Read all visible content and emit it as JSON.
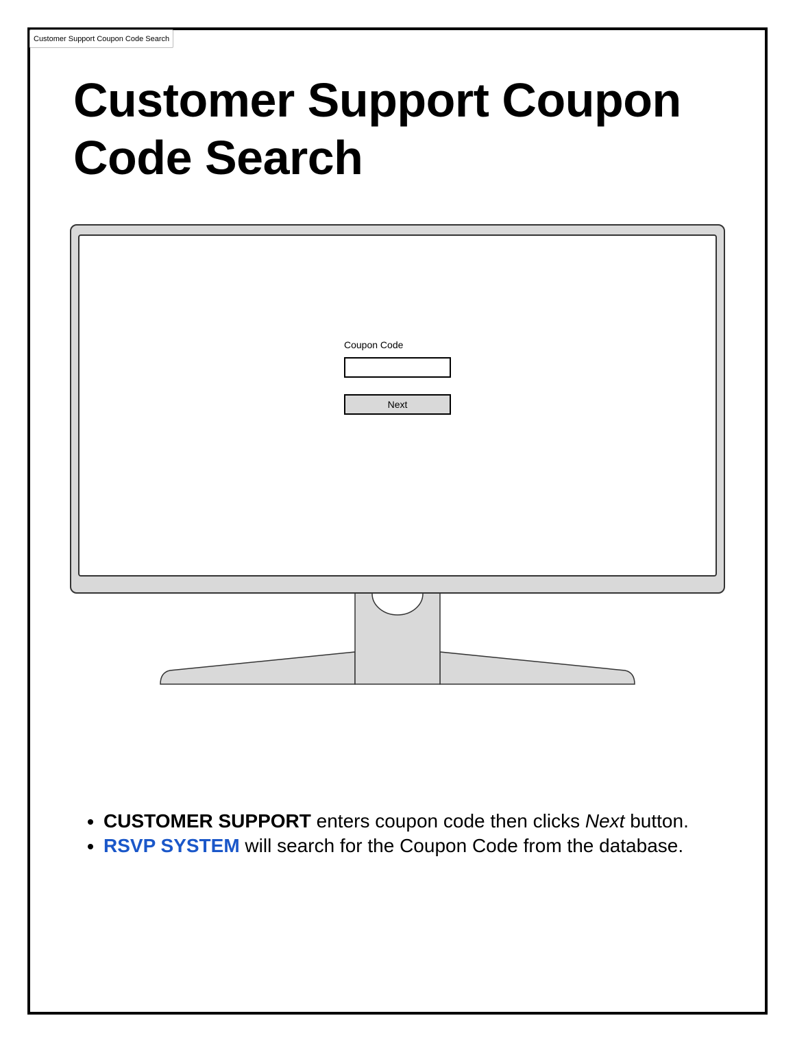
{
  "tab": {
    "label": "Customer Support Coupon Code Search"
  },
  "page": {
    "title": "Customer Support Coupon Code Search"
  },
  "screen": {
    "coupon_label": "Coupon Code",
    "coupon_value": "",
    "next_label": "Next"
  },
  "notes": [
    {
      "actor": "CUSTOMER SUPPORT",
      "text_before": " enters coupon code then clicks ",
      "emphasis": "Next",
      "text_after": " button."
    },
    {
      "actor": "RSVP SYSTEM",
      "text": " will search for the Coupon Code from the database."
    }
  ],
  "colors": {
    "system_actor": "#1a57c9",
    "monitor_fill": "#d9d9d9",
    "border": "#000000"
  }
}
